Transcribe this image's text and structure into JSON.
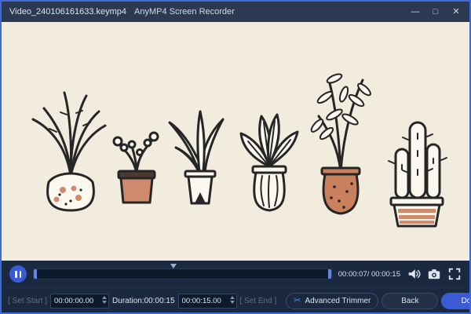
{
  "titlebar": {
    "filename": "Video_240106161633.keymp4",
    "app_name": "AnyMP4 Screen Recorder",
    "minimize": "—",
    "maximize": "□",
    "close": "✕"
  },
  "video": {
    "description": "Hand-drawn illustration of six potted houseplants on a cream background"
  },
  "player": {
    "time_display": "00:00:07/ 00:00:15",
    "current_time": "00:00:07",
    "total_time": "00:00:15",
    "progress_percent": 47
  },
  "trimbar": {
    "set_start": "[ Set Start ]",
    "start_time": "00:00:00.00",
    "duration": "Duration:00:00:15",
    "end_time": "00:00:15.00",
    "set_end": "[ Set End ]",
    "advanced_trimmer": "Advanced Trimmer",
    "advanced_trimmer_icon": "✂",
    "back": "Back",
    "done": "Done"
  },
  "icons": {
    "pause": "pause-icon",
    "volume": "volume-icon",
    "snapshot": "camera-icon",
    "fullscreen": "fullscreen-icon"
  },
  "colors": {
    "accent": "#3b5bd6",
    "window_border": "#3f6cd3",
    "titlebar_bg": "#2b3a52",
    "controls_bg": "#1b2940",
    "video_bg": "#f2ecdf",
    "pot_salmon": "#cf8a6d",
    "pot_terracotta": "#c9805c"
  }
}
